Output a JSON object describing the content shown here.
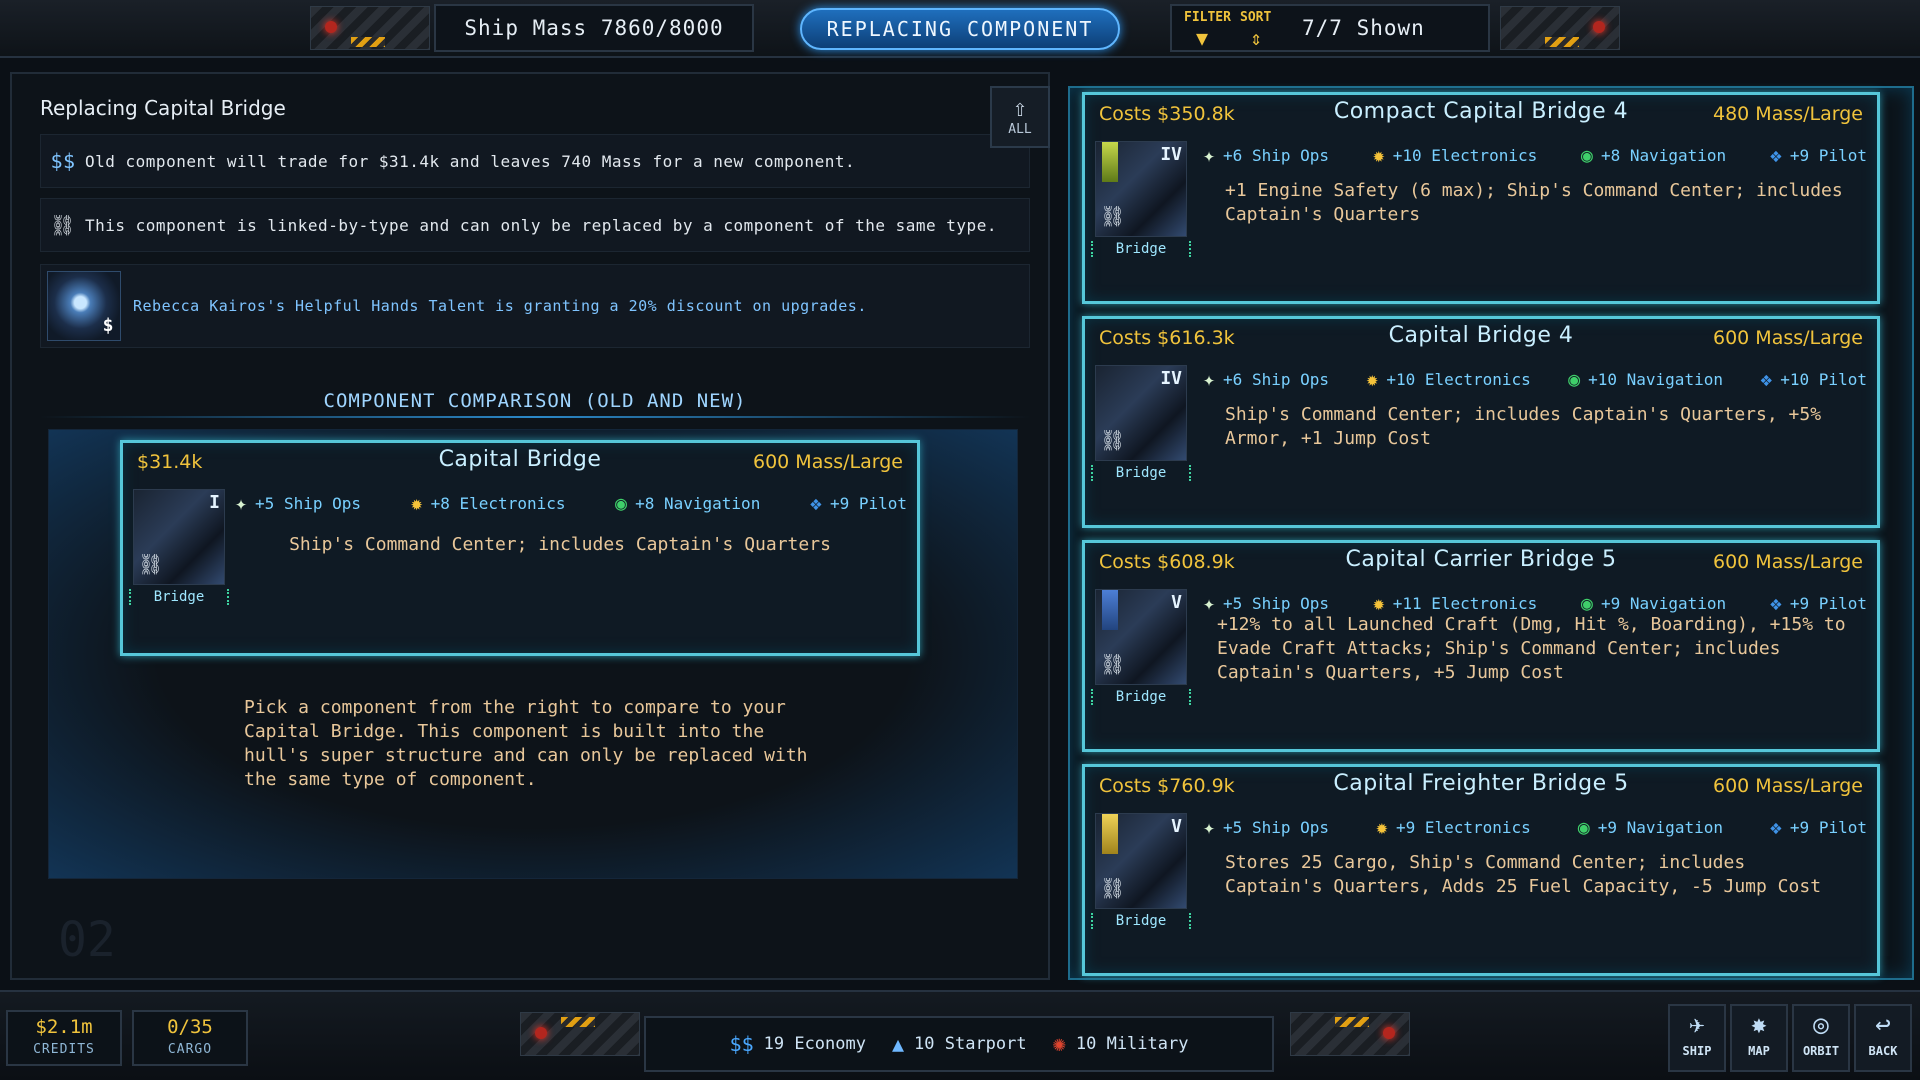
{
  "top": {
    "ship_mass": "Ship Mass 7860/8000",
    "title": "REPLACING COMPONENT",
    "filter_label": "FILTER",
    "sort_label": "SORT",
    "shown": "7/7 Shown"
  },
  "left": {
    "replacing_title": "Replacing Capital Bridge",
    "trade_icon": "$$",
    "trade_text": "Old component will trade for $31.4k and leaves 740 Mass for a new component.",
    "linked_text": "This component is linked-by-type and can only be replaced by a component of the same type.",
    "talent_text": "Rebecca Kairos's Helpful Hands Talent is granting a 20% discount on upgrades.",
    "talent_badge": "$",
    "comparison_header": "COMPONENT COMPARISON (OLD AND NEW)",
    "pick_text": "Pick a component from the right to compare to your Capital Bridge. This component is built into the hull's super structure and can only be replaced with the same type of component.",
    "all_label": "ALL",
    "ghost_num": "02",
    "current": {
      "cost": "$31.4k",
      "name": "Capital Bridge",
      "mass": "600 Mass/Large",
      "tier": "I",
      "category": "Bridge",
      "stats": {
        "ops": "+5 Ship Ops",
        "elec": "+8 Electronics",
        "nav": "+8 Navigation",
        "pilot": "+9 Pilot"
      },
      "desc": "Ship's Command Center; includes Captain's Quarters"
    }
  },
  "cards": [
    {
      "cost": "Costs $350.8k",
      "name": "Compact Capital Bridge 4",
      "mass": "480 Mass/Large",
      "tier": "IV",
      "category": "Bridge",
      "stats": {
        "ops": "+6 Ship Ops",
        "elec": "+10 Electronics",
        "nav": "+8 Navigation",
        "pilot": "+9 Pilot"
      },
      "desc": "+1 Engine Safety (6 max); Ship's Command Center; includes Captain's Quarters"
    },
    {
      "cost": "Costs $616.3k",
      "name": "Capital Bridge 4",
      "mass": "600 Mass/Large",
      "tier": "IV",
      "category": "Bridge",
      "stats": {
        "ops": "+6 Ship Ops",
        "elec": "+10 Electronics",
        "nav": "+10 Navigation",
        "pilot": "+10 Pilot"
      },
      "desc": "Ship's Command Center; includes Captain's Quarters, +5% Armor, +1 Jump Cost"
    },
    {
      "cost": "Costs $608.9k",
      "name": "Capital Carrier Bridge 5",
      "mass": "600 Mass/Large",
      "tier": "V",
      "category": "Bridge",
      "stats": {
        "ops": "+5 Ship Ops",
        "elec": "+11 Electronics",
        "nav": "+9 Navigation",
        "pilot": "+9 Pilot"
      },
      "desc": "+12% to all Launched Craft (Dmg, Hit %, Boarding), +15% to Evade Craft Attacks; Ship's Command Center; includes Captain's Quarters, +5 Jump Cost"
    },
    {
      "cost": "Costs $760.9k",
      "name": "Capital Freighter Bridge 5",
      "mass": "600 Mass/Large",
      "tier": "V",
      "category": "Bridge",
      "stats": {
        "ops": "+5 Ship Ops",
        "elec": "+9 Electronics",
        "nav": "+9 Navigation",
        "pilot": "+9 Pilot"
      },
      "desc": "Stores 25 Cargo, Ship's Command Center; includes Captain's Quarters, Adds 25 Fuel Capacity, -5 Jump Cost"
    }
  ],
  "bottom": {
    "credits_value": "$2.1m",
    "credits_label": "CREDITS",
    "cargo_value": "0/35",
    "cargo_label": "CARGO",
    "economy": "19 Economy",
    "starport": "10 Starport",
    "military": "10 Military",
    "nav": [
      "SHIP",
      "MAP",
      "ORBIT",
      "BACK"
    ]
  },
  "colors": {
    "gold": "#f0c33c",
    "accent_blue": "#5fb6ff",
    "card_border": "#56c7d9",
    "desc_text": "#e8c79a"
  }
}
